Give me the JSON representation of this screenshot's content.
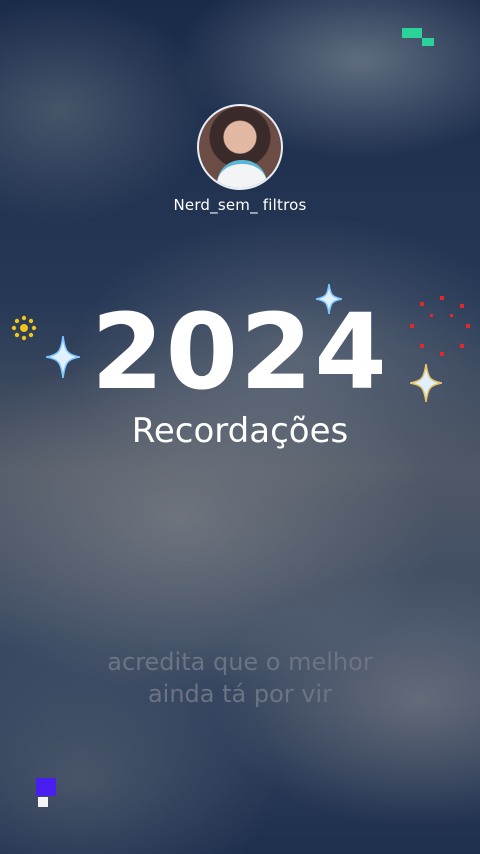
{
  "profile": {
    "username": "Nerd_sem_ filtros"
  },
  "banner": {
    "year": "2024",
    "subtitle": "Recordações"
  },
  "caption": {
    "line1": "acredita que o melhor",
    "line2": "ainda tá por vir"
  },
  "colors": {
    "sparkle": "#dff1ff",
    "sparkle_glow": "#7fc6ff",
    "sparkle_gold": "#e7c46a",
    "sun": "#f2c318",
    "firework": "#e02a2a",
    "pixel_green": "#2ad39a",
    "pixel_purple": "#4a1df0"
  }
}
